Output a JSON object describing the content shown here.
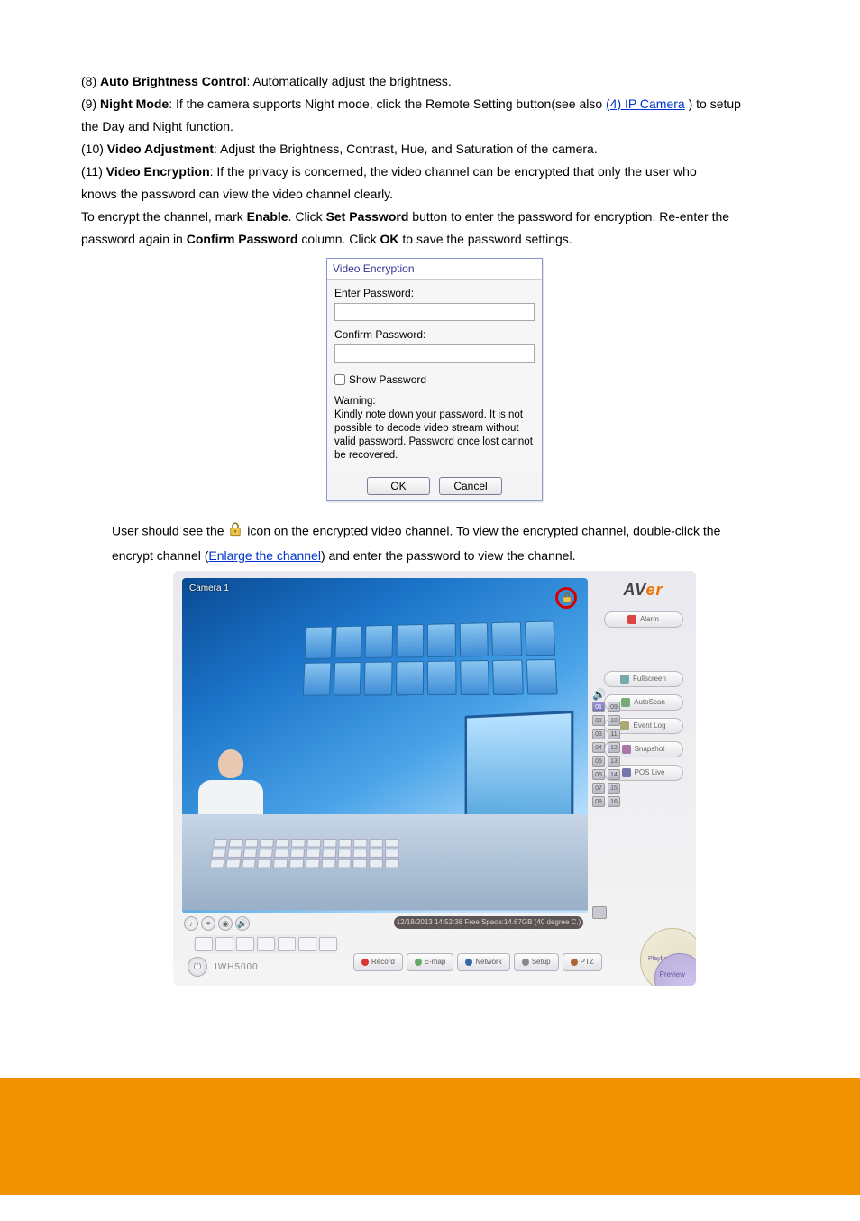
{
  "body": {
    "line1_prefix": "(8) ",
    "line1_bold": "Auto Brightness Control",
    "line1_rest": ": Automatically adjust the brightness.",
    "line2_prefix": "(9) ",
    "line2_bold": "Night Mode",
    "line2_rest": ": If the camera supports Night mode, click the Remote Setting button(see also ",
    "line2_link": "(4) IP Camera",
    "line2_after_link": " ) to setup",
    "line2_cont": "the Day and Night function.",
    "line3_prefix": "(10) ",
    "line3_bold": "Video Adjustment",
    "line3_rest": ": Adjust the Brightness, Contrast, Hue, and Saturation of the camera.",
    "line4_prefix": "(11) ",
    "line4_bold": "Video Encryption",
    "line4_rest": ": If the privacy is concerned, the video channel can be encrypted that only the user who",
    "line4_cont": "knows the password can view the video channel clearly.",
    "line5_prefix": "To encrypt the channel, mark ",
    "line5_bold1": "Enable",
    "line5_after1": ". Click ",
    "line5_bold2": "Set Password",
    "line5_after2": " button to enter the password for encryption. Re-enter the",
    "line5_cont_prefix": "password again in ",
    "line5_bold3": "Confirm Password",
    "line5_after3": " column. Click ",
    "line5_bold4": "OK",
    "line5_after4": " to save the password settings.",
    "icon_line_prefix": "User should see the ",
    "icon_line_after": " icon on the encrypted video channel. To view the encrypted channel, double-click the",
    "icon_line_cont_prefix": "encrypt channel (",
    "icon_line_link": "Enlarge the channel",
    "icon_line_cont_after": ") and enter the password to view the channel."
  },
  "dialog": {
    "title": "Video Encryption",
    "enter_label": "Enter Password:",
    "confirm_label": "Confirm Password:",
    "show_pw": "Show Password",
    "warning_head": "Warning:",
    "warning_body": "Kindly note down your password. It is not possible to decode video stream without valid password. Password once lost cannot be recovered.",
    "ok": "OK",
    "cancel": "Cancel"
  },
  "app": {
    "camera_label": "Camera 1",
    "brand_av": "AV",
    "brand_er": "er",
    "btn_alarm": "Alarm",
    "btn_fullscreen": "Fullscreen",
    "btn_autoscan": "AutoScan",
    "btn_eventlog": "Event Log",
    "btn_snapshot": "Snapshot",
    "btn_poslive": "POS Live",
    "cam_numbers": [
      "01",
      "09",
      "02",
      "10",
      "03",
      "11",
      "04",
      "12",
      "05",
      "13",
      "06",
      "14",
      "07",
      "15",
      "08",
      "16"
    ],
    "status_text": "12/18/2013 14:52:38 Free Space:14.67GB (40 degree C.)",
    "bottom": {
      "record": "Record",
      "emap": "E-map",
      "network": "Network",
      "setup": "Setup",
      "ptz": "PTZ"
    },
    "model": "IWH5000",
    "corner_playback": "Playback",
    "corner_preview": "Preview"
  }
}
